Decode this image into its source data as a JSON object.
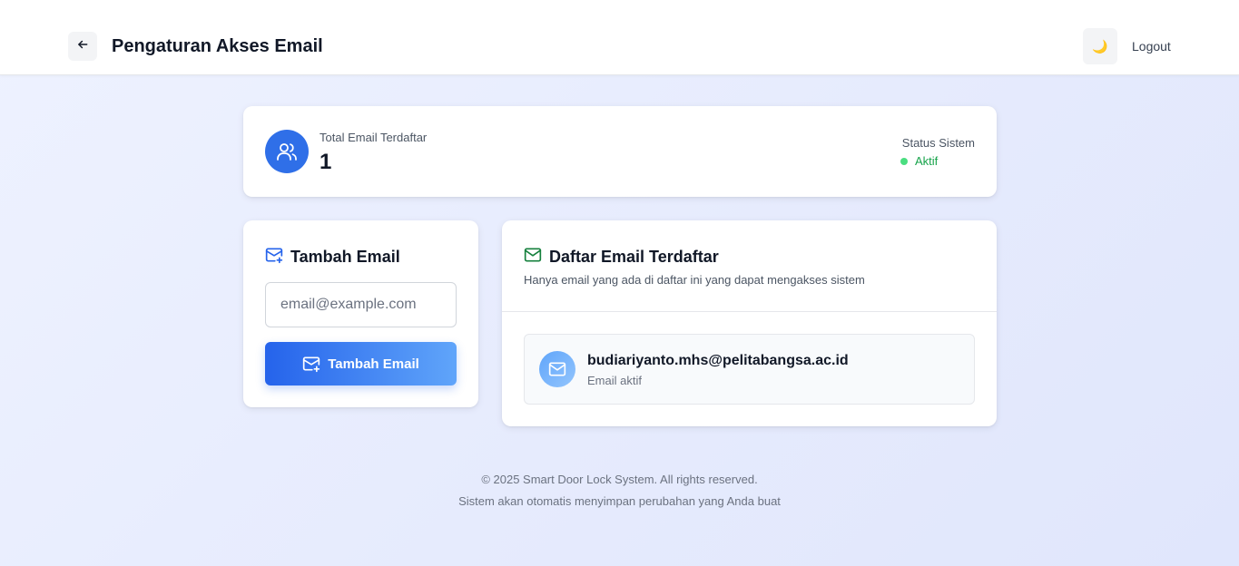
{
  "header": {
    "title": "Pengaturan Akses Email",
    "back_icon": "arrow-left-icon",
    "theme_icon": "moon-icon",
    "theme_glyph": "🌙",
    "logout_label": "Logout"
  },
  "stats": {
    "icon": "users-icon",
    "total_label": "Total Email Terdaftar",
    "total_value": "1",
    "status_label": "Status Sistem",
    "status_value": "Aktif"
  },
  "add_email": {
    "icon": "mail-plus-icon",
    "title": "Tambah Email",
    "input_placeholder": "email@example.com",
    "input_value": "",
    "button_label": "Tambah Email"
  },
  "email_list": {
    "icon": "mail-icon",
    "title": "Daftar Email Terdaftar",
    "subtitle": "Hanya email yang ada di daftar ini yang dapat mengakses sistem",
    "items": [
      {
        "email": "budiariyanto.mhs@pelitabangsa.ac.id",
        "status": "Email aktif"
      }
    ]
  },
  "footer": {
    "copyright": "© 2025 Smart Door Lock System. All rights reserved.",
    "note": "Sistem akan otomatis menyimpan perubahan yang Anda buat"
  },
  "colors": {
    "accent": "#2563eb",
    "accent_light": "#60a5fa",
    "status_green": "#16a34a",
    "status_dot": "#4ade80",
    "list_icon_green": "#15803d"
  }
}
